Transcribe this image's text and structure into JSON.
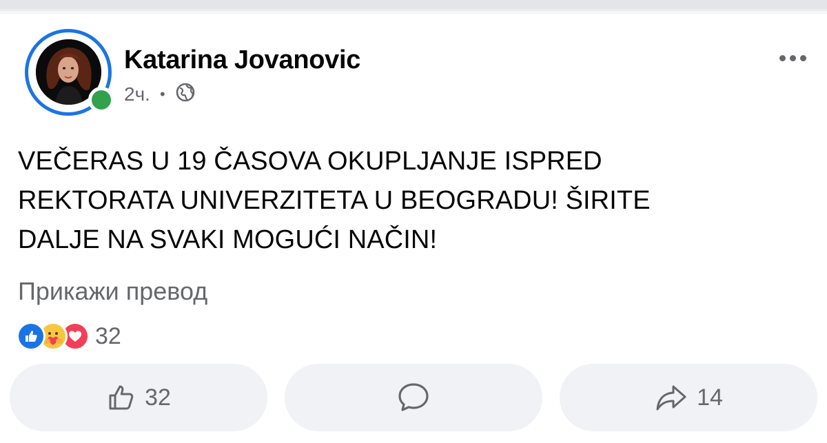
{
  "post": {
    "author_name": "Katarina Jovanovic",
    "time": "2ч.",
    "separator": "•",
    "audience_icon": "globe-icon",
    "text_lines": [
      "VEČERAS U 19 ČASOVA OKUPLJANJE ISPRED",
      "REKTORATA UNIVERZITETA U BEOGRADU! ŠIRITE",
      "DALJE NA SVAKI MOGUĆI NAČIN!"
    ],
    "translate_label": "Прикажи превод"
  },
  "reactions": {
    "icons": [
      "like-reaction-icon",
      "care-reaction-icon",
      "love-reaction-icon"
    ],
    "count": "32"
  },
  "actions": {
    "like_count": "32",
    "share_count": "14"
  },
  "colors": {
    "accent": "#1b74e4",
    "online": "#31a24c",
    "secondary_text": "#65676b",
    "button_bg": "#f0f2f5",
    "love": "#f33e58",
    "care": "#f7c740"
  }
}
